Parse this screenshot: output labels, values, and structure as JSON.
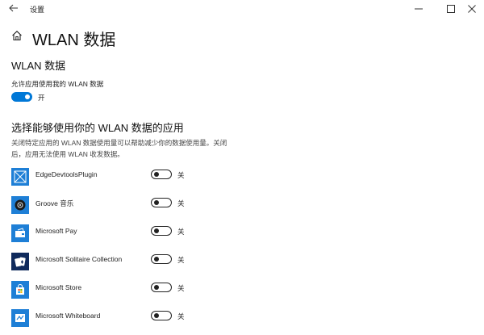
{
  "window": {
    "title": "设置",
    "back_icon": "back-arrow-icon",
    "minimize_icon": "minimize-icon",
    "maximize_icon": "maximize-icon",
    "close_icon": "close-icon"
  },
  "header": {
    "home_icon": "home-icon",
    "title": "WLAN 数据"
  },
  "wlan_section": {
    "title": "WLAN 数据",
    "allow_label": "允许应用使用我的 WLAN 数据",
    "toggle_state": "开",
    "toggle_on": true
  },
  "apps_section": {
    "title": "选择能够使用你的 WLAN 数据的应用",
    "description": "关闭特定应用的 WLAN 数据使用量可以帮助减少你的数据使用量。关闭后，应用无法使用 WLAN 收发数据。",
    "apps": [
      {
        "name": "EdgeDevtoolsPlugin",
        "icon": "edge-devtools-icon",
        "state": "关"
      },
      {
        "name": "Groove 音乐",
        "icon": "groove-music-icon",
        "state": "关"
      },
      {
        "name": "Microsoft Pay",
        "icon": "wallet-icon",
        "state": "关"
      },
      {
        "name": "Microsoft Solitaire Collection",
        "icon": "solitaire-cards-icon",
        "state": "关"
      },
      {
        "name": "Microsoft Store",
        "icon": "store-bag-icon",
        "state": "关"
      },
      {
        "name": "Microsoft Whiteboard",
        "icon": "whiteboard-icon",
        "state": "关"
      }
    ]
  },
  "colors": {
    "accent": "#0078d7",
    "app_tile": "#1e7fd6",
    "solitaire_tile": "#0f2a5c"
  }
}
